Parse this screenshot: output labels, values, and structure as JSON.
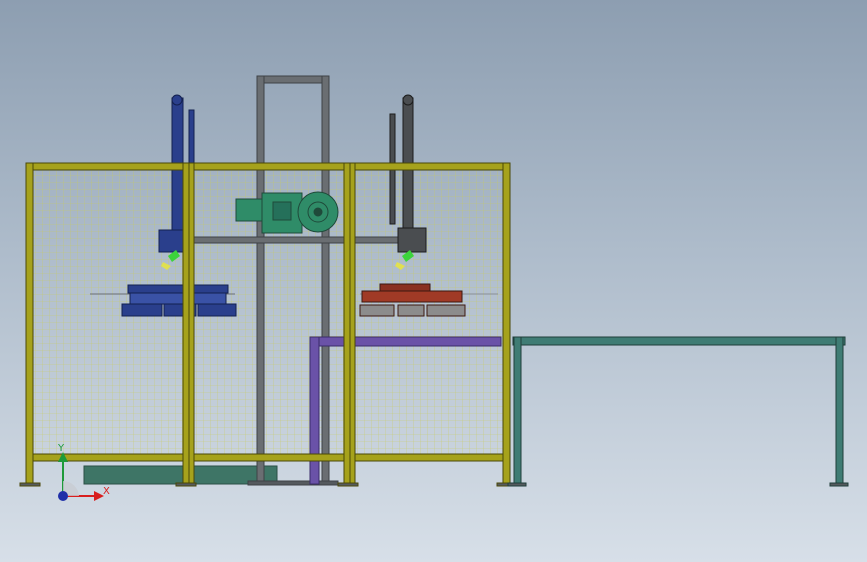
{
  "view": {
    "background_top": "#8d9eb1",
    "background_bottom": "#d7dfe8"
  },
  "colors": {
    "fence_frame": "#a6a21c",
    "fence_mesh": "#c9cc55",
    "steel_gray": "#555a5e",
    "motor_green": "#2f8c68",
    "conveyor_frame": "#3f7c74",
    "gripper_left": "#2a3f8c",
    "gripper_right": "#8a3020",
    "duct_purple": "#6a52a8",
    "base_plate": "#3e7566"
  },
  "triad": {
    "x_label": "X",
    "y_label": "Y",
    "x_color": "#d81e1e",
    "y_color": "#1e9a3a",
    "z_color": "#1f2fa8",
    "icons": [
      "axis-triad-icon"
    ]
  }
}
